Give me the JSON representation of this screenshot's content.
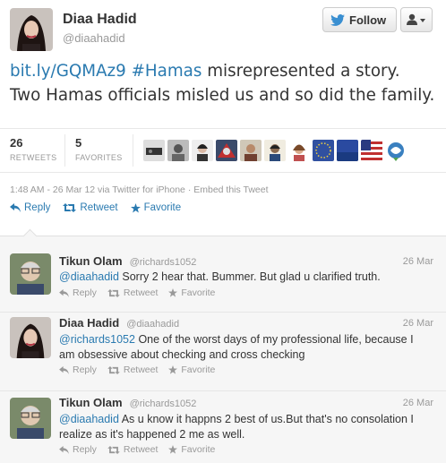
{
  "author": {
    "name": "Diaa Hadid",
    "handle": "@diaahadid"
  },
  "buttons": {
    "follow": "Follow"
  },
  "tweet": {
    "link": "bit.ly/GQMAz9",
    "hashtag": "#Hamas",
    "text_part1": " misrepresented a story.",
    "text_part2": "Two Hamas officials misled us and so did the family."
  },
  "stats": {
    "retweets_count": "26",
    "retweets_label": "RETWEETS",
    "favorites_count": "5",
    "favorites_label": "FAVORITES"
  },
  "meta": "1:48 AM - 26 Mar 12 via Twitter for iPhone · Embed this Tweet",
  "actions": {
    "reply": "Reply",
    "retweet": "Retweet",
    "favorite": "Favorite"
  },
  "replies": [
    {
      "name": "Tikun Olam",
      "handle": "@richards1052",
      "date": "26 Mar",
      "mention": "@diaahadid",
      "text": " Sorry 2 hear that. Bummer. But glad u clarified truth.",
      "text2": ""
    },
    {
      "name": "Diaa Hadid",
      "handle": "@diaahadid",
      "date": "26 Mar",
      "mention": "@richards1052",
      "text": " One of the worst days of my professional life, because I",
      "text2": "am obsessive about checking and cross checking"
    },
    {
      "name": "Tikun Olam",
      "handle": "@richards1052",
      "date": "26 Mar",
      "mention": "@diaahadid",
      "text": " As u know it happns 2 best of us.But that's no consolation I",
      "text2": "realize as it's happened 2 me as well."
    }
  ],
  "colors": {
    "link": "#2a7ab0",
    "bird": "#3a8fd1"
  }
}
